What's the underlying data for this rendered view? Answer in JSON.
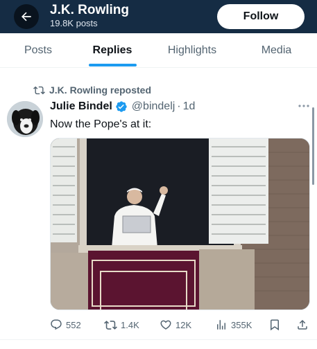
{
  "header": {
    "title": "J.K. Rowling",
    "posts_count": "19.8K posts",
    "follow_label": "Follow",
    "background": "#152c44"
  },
  "tabs": [
    {
      "label": "Posts",
      "active": false
    },
    {
      "label": "Replies",
      "active": true
    },
    {
      "label": "Highlights",
      "active": false
    },
    {
      "label": "Media",
      "active": false
    }
  ],
  "tweet": {
    "repost_label": "J.K. Rowling reposted",
    "author_name": "Julie Bindel",
    "verified": true,
    "handle": "@bindelj",
    "separator": "·",
    "time": "1d",
    "text": "Now the Pope's at it:",
    "media_icon": "photo-pope-balcony",
    "actions": {
      "replies": "552",
      "reposts": "1.4K",
      "likes": "12K",
      "views": "355K"
    }
  },
  "colors": {
    "accent": "#1d9bf0",
    "secondary_text": "#536471",
    "primary_text": "#0f1419"
  }
}
